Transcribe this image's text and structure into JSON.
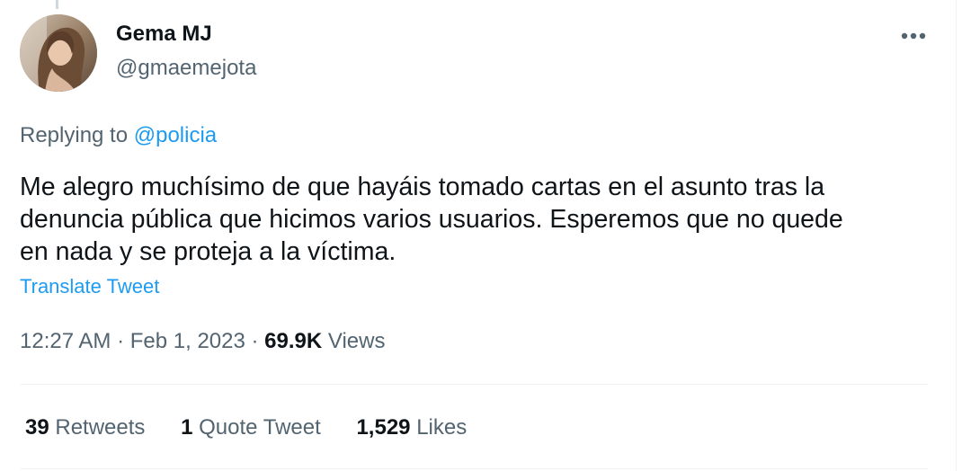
{
  "author": {
    "name": "Gema MJ",
    "handle": "@gmaemejota"
  },
  "menu": {
    "icon": "more-horizontal-icon"
  },
  "reply": {
    "prefix": "Replying to ",
    "mention": "@policia"
  },
  "tweet": {
    "text": "Me alegro muchísimo de que hayáis tomado cartas en el asunto tras la\ndenuncia pública que hicimos varios usuarios. Esperemos que no quede\nen nada y se proteja a la víctima.",
    "translate_label": "Translate Tweet"
  },
  "meta": {
    "time": "12:27 AM",
    "separator": " · ",
    "date": "Feb 1, 2023",
    "views_count": "69.9K",
    "views_label": "Views"
  },
  "stats": {
    "retweets_count": "39",
    "retweets_label": "Retweets",
    "quotes_count": "1",
    "quotes_label": "Quote Tweet",
    "likes_count": "1,529",
    "likes_label": "Likes"
  },
  "colors": {
    "accent": "#1d9bf0",
    "secondary_text": "#536471",
    "primary_text": "#0f1419"
  }
}
